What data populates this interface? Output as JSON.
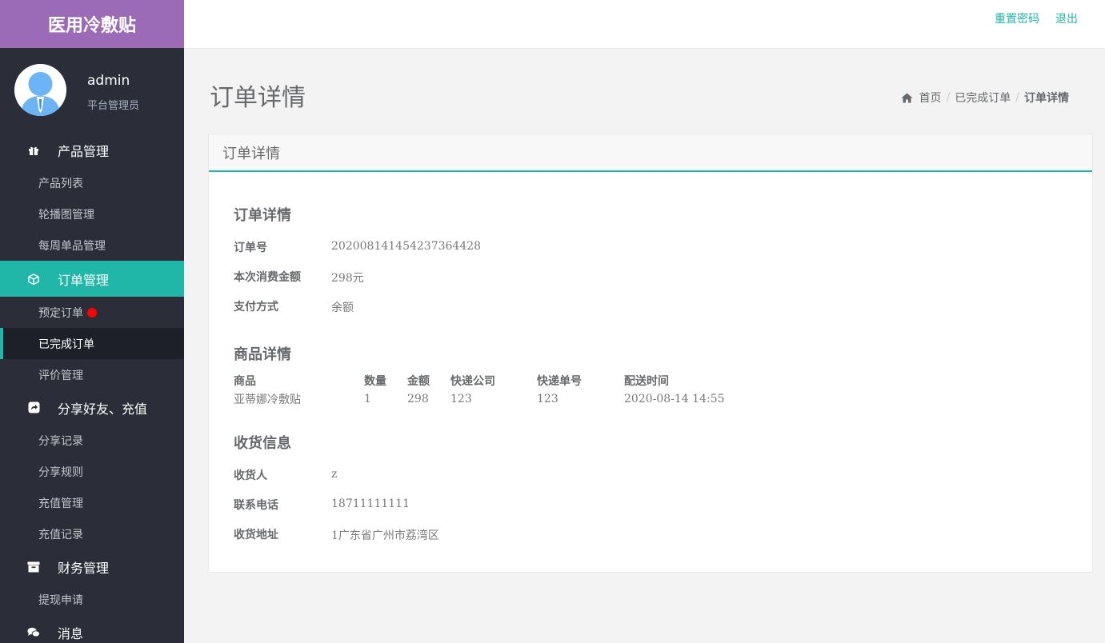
{
  "app": {
    "title": "医用冷敷贴"
  },
  "profile": {
    "name": "admin",
    "role": "平台管理员"
  },
  "nav": {
    "product": {
      "label": "产品管理",
      "items": [
        "产品列表",
        "轮播图管理",
        "每周单品管理"
      ]
    },
    "order": {
      "label": "订单管理",
      "items": [
        "预定订单",
        "已完成订单",
        "评价管理"
      ]
    },
    "share": {
      "label": "分享好友、充值",
      "items": [
        "分享记录",
        "分享规则",
        "充值管理",
        "充值记录"
      ]
    },
    "finance": {
      "label": "财务管理",
      "items": [
        "提现申请"
      ]
    },
    "message": {
      "label": "消息"
    }
  },
  "topbar": {
    "reset_password": "重置密码",
    "logout": "退出"
  },
  "page": {
    "title": "订单详情"
  },
  "breadcrumb": {
    "home": "首页",
    "parent": "已完成订单",
    "current": "订单详情"
  },
  "panel": {
    "title": "订单详情",
    "order_section": {
      "title": "订单详情",
      "order_no_label": "订单号",
      "order_no": "202008141454237364428",
      "amount_label": "本次消费金额",
      "amount": "298元",
      "pay_label": "支付方式",
      "pay": "余额"
    },
    "goods_section": {
      "title": "商品详情",
      "headers": {
        "goods": "商品",
        "qty": "数量",
        "price": "金额",
        "courier": "快递公司",
        "tracking": "快递单号",
        "time": "配送时间"
      },
      "row": {
        "goods": "亚蒂娜冷敷贴",
        "qty": "1",
        "price": "298",
        "courier": "123",
        "tracking": "123",
        "time": "2020-08-14 14:55"
      }
    },
    "shipping_section": {
      "title": "收货信息",
      "receiver_label": "收货人",
      "receiver": "z",
      "phone_label": "联系电话",
      "phone": "18711111111",
      "address_label": "收货地址",
      "address": "1广东省广州市荔湾区"
    }
  }
}
